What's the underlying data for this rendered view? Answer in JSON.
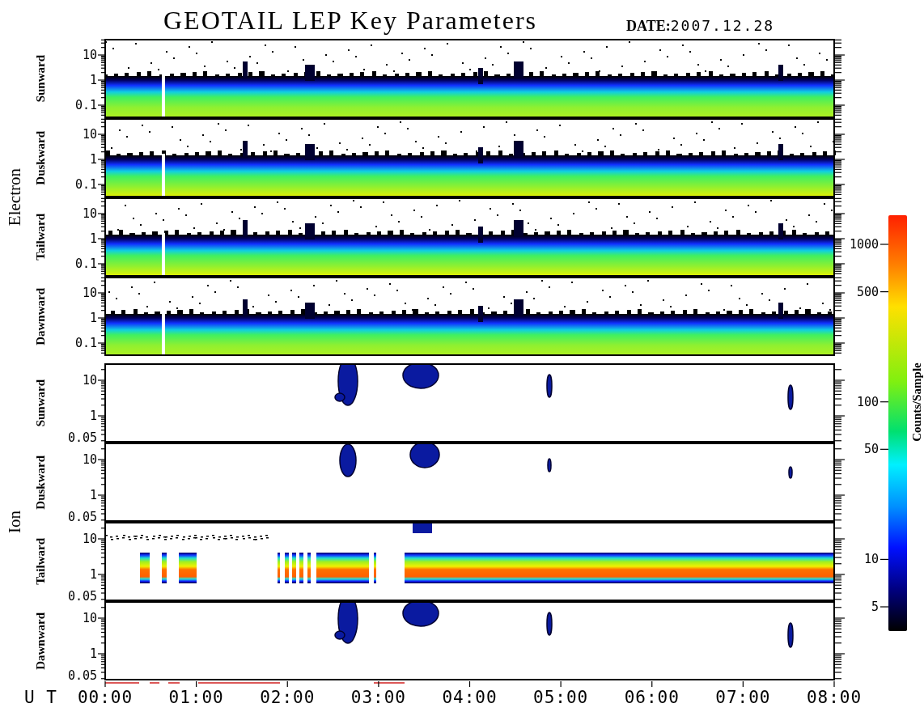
{
  "title": "GEOTAIL LEP Key Parameters",
  "date": {
    "label": "DATE:",
    "value": "2007.12.28"
  },
  "groups": [
    {
      "label": "Electron",
      "kind": "electron",
      "panels": [
        {
          "label": "Sunward",
          "kind": "band",
          "yticks": [
            "10",
            "1",
            "0.1"
          ]
        },
        {
          "label": "Duskward",
          "kind": "band",
          "yticks": [
            "10",
            "1",
            "0.1"
          ]
        },
        {
          "label": "Tailward",
          "kind": "band",
          "yticks": [
            "10",
            "1",
            "0.1"
          ]
        },
        {
          "label": "Dawnward",
          "kind": "band",
          "yticks": [
            "10",
            "1",
            "0.1"
          ]
        }
      ]
    },
    {
      "label": "Ion",
      "kind": "ion",
      "panels": [
        {
          "label": "Sunward",
          "kind": "bursts",
          "yticks": [
            "10",
            "1",
            "0.05"
          ]
        },
        {
          "label": "Duskward",
          "kind": "bursts",
          "yticks": [
            "10",
            "1",
            "0.05"
          ]
        },
        {
          "label": "Tailward",
          "kind": "beam",
          "yticks": [
            "10",
            "1",
            "0.05"
          ]
        },
        {
          "label": "Dawnward",
          "kind": "bursts",
          "yticks": [
            "10",
            "1",
            "0.05"
          ]
        }
      ]
    }
  ],
  "x_axis": {
    "label": "U T",
    "ticks": [
      "00:00",
      "01:00",
      "02:00",
      "03:00",
      "04:00",
      "05:00",
      "06:00",
      "07:00",
      "08:00"
    ]
  },
  "colorbar": {
    "label": "Counts/Sample",
    "ticks": [
      "1000",
      "500",
      "100",
      "50",
      "10",
      "5"
    ]
  }
}
